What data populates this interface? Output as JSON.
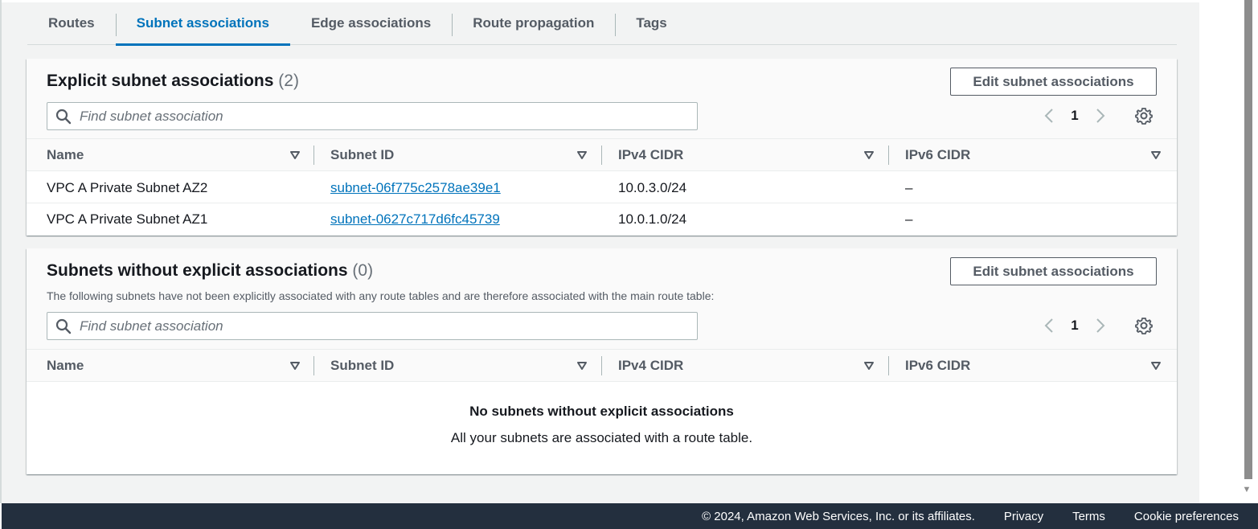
{
  "tabs": [
    {
      "label": "Routes",
      "active": false
    },
    {
      "label": "Subnet associations",
      "active": true
    },
    {
      "label": "Edge associations",
      "active": false
    },
    {
      "label": "Route propagation",
      "active": false
    },
    {
      "label": "Tags",
      "active": false
    }
  ],
  "explicit": {
    "title": "Explicit subnet associations",
    "count": "(2)",
    "edit_button": "Edit subnet associations",
    "search_placeholder": "Find subnet association",
    "page": "1",
    "columns": [
      "Name",
      "Subnet ID",
      "IPv4 CIDR",
      "IPv6 CIDR"
    ],
    "rows": [
      {
        "name": "VPC A Private Subnet AZ2",
        "subnet_id": "subnet-06f775c2578ae39e1",
        "ipv4": "10.0.3.0/24",
        "ipv6": "–"
      },
      {
        "name": "VPC A Private Subnet AZ1",
        "subnet_id": "subnet-0627c717d6fc45739",
        "ipv4": "10.0.1.0/24",
        "ipv6": "–"
      }
    ]
  },
  "implicit": {
    "title": "Subnets without explicit associations",
    "count": "(0)",
    "description": "The following subnets have not been explicitly associated with any route tables and are therefore associated with the main route table:",
    "edit_button": "Edit subnet associations",
    "search_placeholder": "Find subnet association",
    "page": "1",
    "columns": [
      "Name",
      "Subnet ID",
      "IPv4 CIDR",
      "IPv6 CIDR"
    ],
    "empty_title": "No subnets without explicit associations",
    "empty_desc": "All your subnets are associated with a route table."
  },
  "footer": {
    "copyright": "© 2024, Amazon Web Services, Inc. or its affiliates.",
    "privacy": "Privacy",
    "terms": "Terms",
    "cookies": "Cookie preferences"
  },
  "colors": {
    "accent": "#0073bb",
    "footer_bg": "#232f3e",
    "page_bg": "#f2f3f3"
  }
}
